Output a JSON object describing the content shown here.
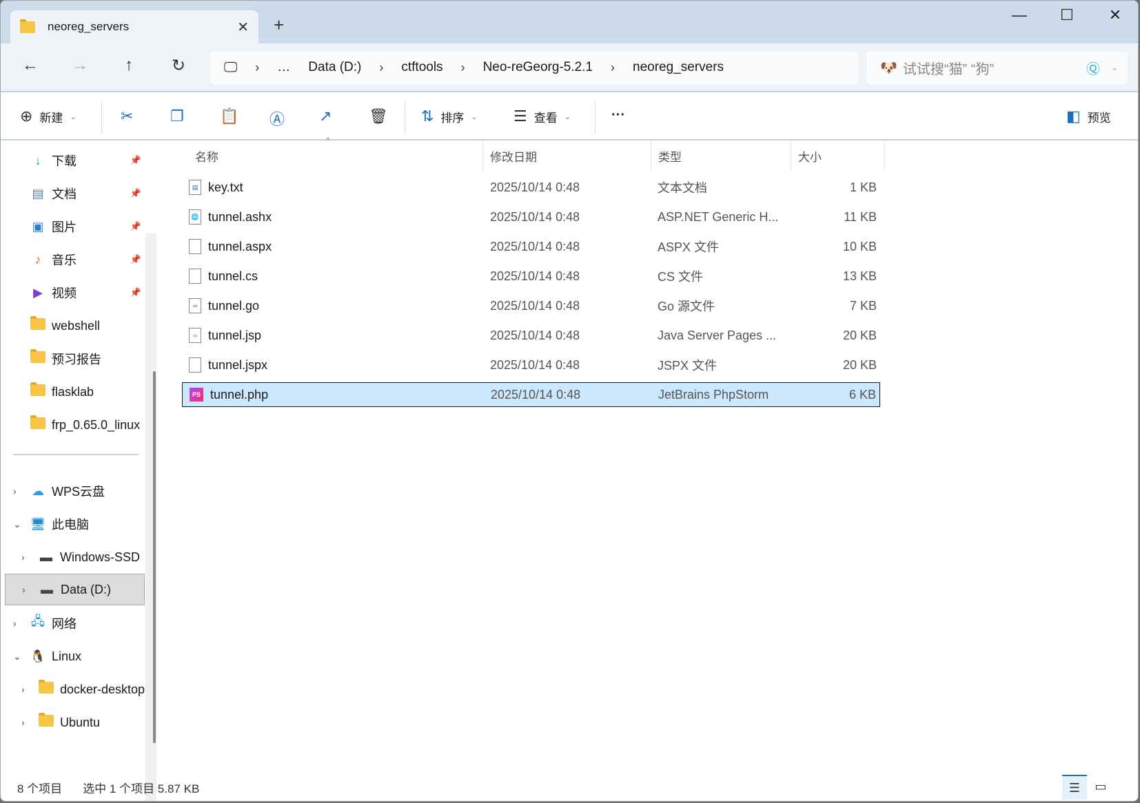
{
  "tab": {
    "title": "neoreg_servers",
    "close": "✕",
    "new": "+"
  },
  "window": {
    "minimize": "—",
    "maximize": "☐",
    "close": "✕"
  },
  "address": {
    "crumbs": [
      "…",
      "Data (D:)",
      "ctftools",
      "Neo-reGeorg-5.2.1",
      "neoreg_servers"
    ],
    "sep": "›"
  },
  "search": {
    "placeholder": "试试搜“猫” “狗”"
  },
  "toolbar": {
    "new": "新建",
    "sort": "排序",
    "view": "查看",
    "more": "···",
    "preview": "预览"
  },
  "sidebar": {
    "items": [
      {
        "label": "下载",
        "pinned": true
      },
      {
        "label": "文档",
        "pinned": true
      },
      {
        "label": "图片",
        "pinned": true
      },
      {
        "label": "音乐",
        "pinned": true
      },
      {
        "label": "视频",
        "pinned": true
      },
      {
        "label": "webshell"
      },
      {
        "label": "预习报告"
      },
      {
        "label": "flasklab"
      },
      {
        "label": "frp_0.65.0_linux"
      },
      {
        "label": "WPS云盘"
      },
      {
        "label": "此电脑"
      },
      {
        "label": "Windows-SSD"
      },
      {
        "label": "Data (D:)"
      },
      {
        "label": "网络"
      },
      {
        "label": "Linux"
      },
      {
        "label": "docker-desktop"
      },
      {
        "label": "Ubuntu"
      }
    ]
  },
  "columns": {
    "name": "名称",
    "date": "修改日期",
    "type": "类型",
    "size": "大小"
  },
  "files": [
    {
      "name": "key.txt",
      "date": "2025/10/14 0:48",
      "type": "文本文档",
      "size": "1 KB"
    },
    {
      "name": "tunnel.ashx",
      "date": "2025/10/14 0:48",
      "type": "ASP.NET Generic H...",
      "size": "11 KB"
    },
    {
      "name": "tunnel.aspx",
      "date": "2025/10/14 0:48",
      "type": "ASPX 文件",
      "size": "10 KB"
    },
    {
      "name": "tunnel.cs",
      "date": "2025/10/14 0:48",
      "type": "CS 文件",
      "size": "13 KB"
    },
    {
      "name": "tunnel.go",
      "date": "2025/10/14 0:48",
      "type": "Go 源文件",
      "size": "7 KB"
    },
    {
      "name": "tunnel.jsp",
      "date": "2025/10/14 0:48",
      "type": "Java Server Pages ...",
      "size": "20 KB"
    },
    {
      "name": "tunnel.jspx",
      "date": "2025/10/14 0:48",
      "type": "JSPX 文件",
      "size": "20 KB"
    },
    {
      "name": "tunnel.php",
      "date": "2025/10/14 0:48",
      "type": "JetBrains PhpStorm",
      "size": "6 KB"
    }
  ],
  "status": {
    "count": "8 个项目",
    "selected": "选中 1 个项目  5.87 KB"
  }
}
